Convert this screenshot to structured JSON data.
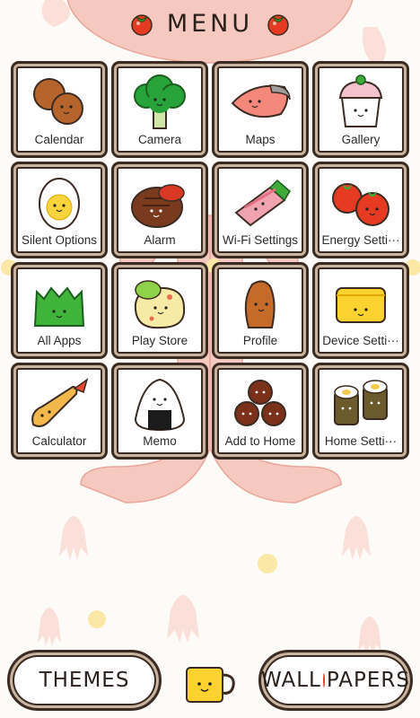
{
  "header": {
    "title": "MENU"
  },
  "tiles": [
    {
      "label": "Calendar"
    },
    {
      "label": "Camera"
    },
    {
      "label": "Maps"
    },
    {
      "label": "Gallery"
    },
    {
      "label": "Silent Options"
    },
    {
      "label": "Alarm"
    },
    {
      "label": "Wi-Fi Settings"
    },
    {
      "label": "Energy Setti···"
    },
    {
      "label": "All Apps"
    },
    {
      "label": "Play Store"
    },
    {
      "label": "Profile"
    },
    {
      "label": "Device Setti···"
    },
    {
      "label": "Calculator"
    },
    {
      "label": "Memo"
    },
    {
      "label": "Add to Home"
    },
    {
      "label": "Home Setti···"
    }
  ],
  "bottom": {
    "themes_label": "THEMES",
    "wall_label": "WALL",
    "papers_label": "PAPERS"
  },
  "icons": {
    "header": "tomato-icon",
    "tiles": [
      "meatballs-icon",
      "broccoli-icon",
      "salmon-icon",
      "cupcake-icon",
      "egg-icon",
      "hamburg-steak-icon",
      "bacon-roll-icon",
      "cherry-tomatoes-icon",
      "lettuce-icon",
      "potato-salad-icon",
      "croquette-icon",
      "tamagoyaki-icon",
      "fried-shrimp-icon",
      "onigiri-icon",
      "meatball-trio-icon",
      "sushi-roll-icon"
    ],
    "bottom": "mug-icon"
  },
  "colors": {
    "background": "#fdfbf7",
    "border": "#3b2b22",
    "octopus": "#f6c9c0",
    "accent_red": "#e0402a",
    "yellow_dot": "#fbe8a6"
  }
}
